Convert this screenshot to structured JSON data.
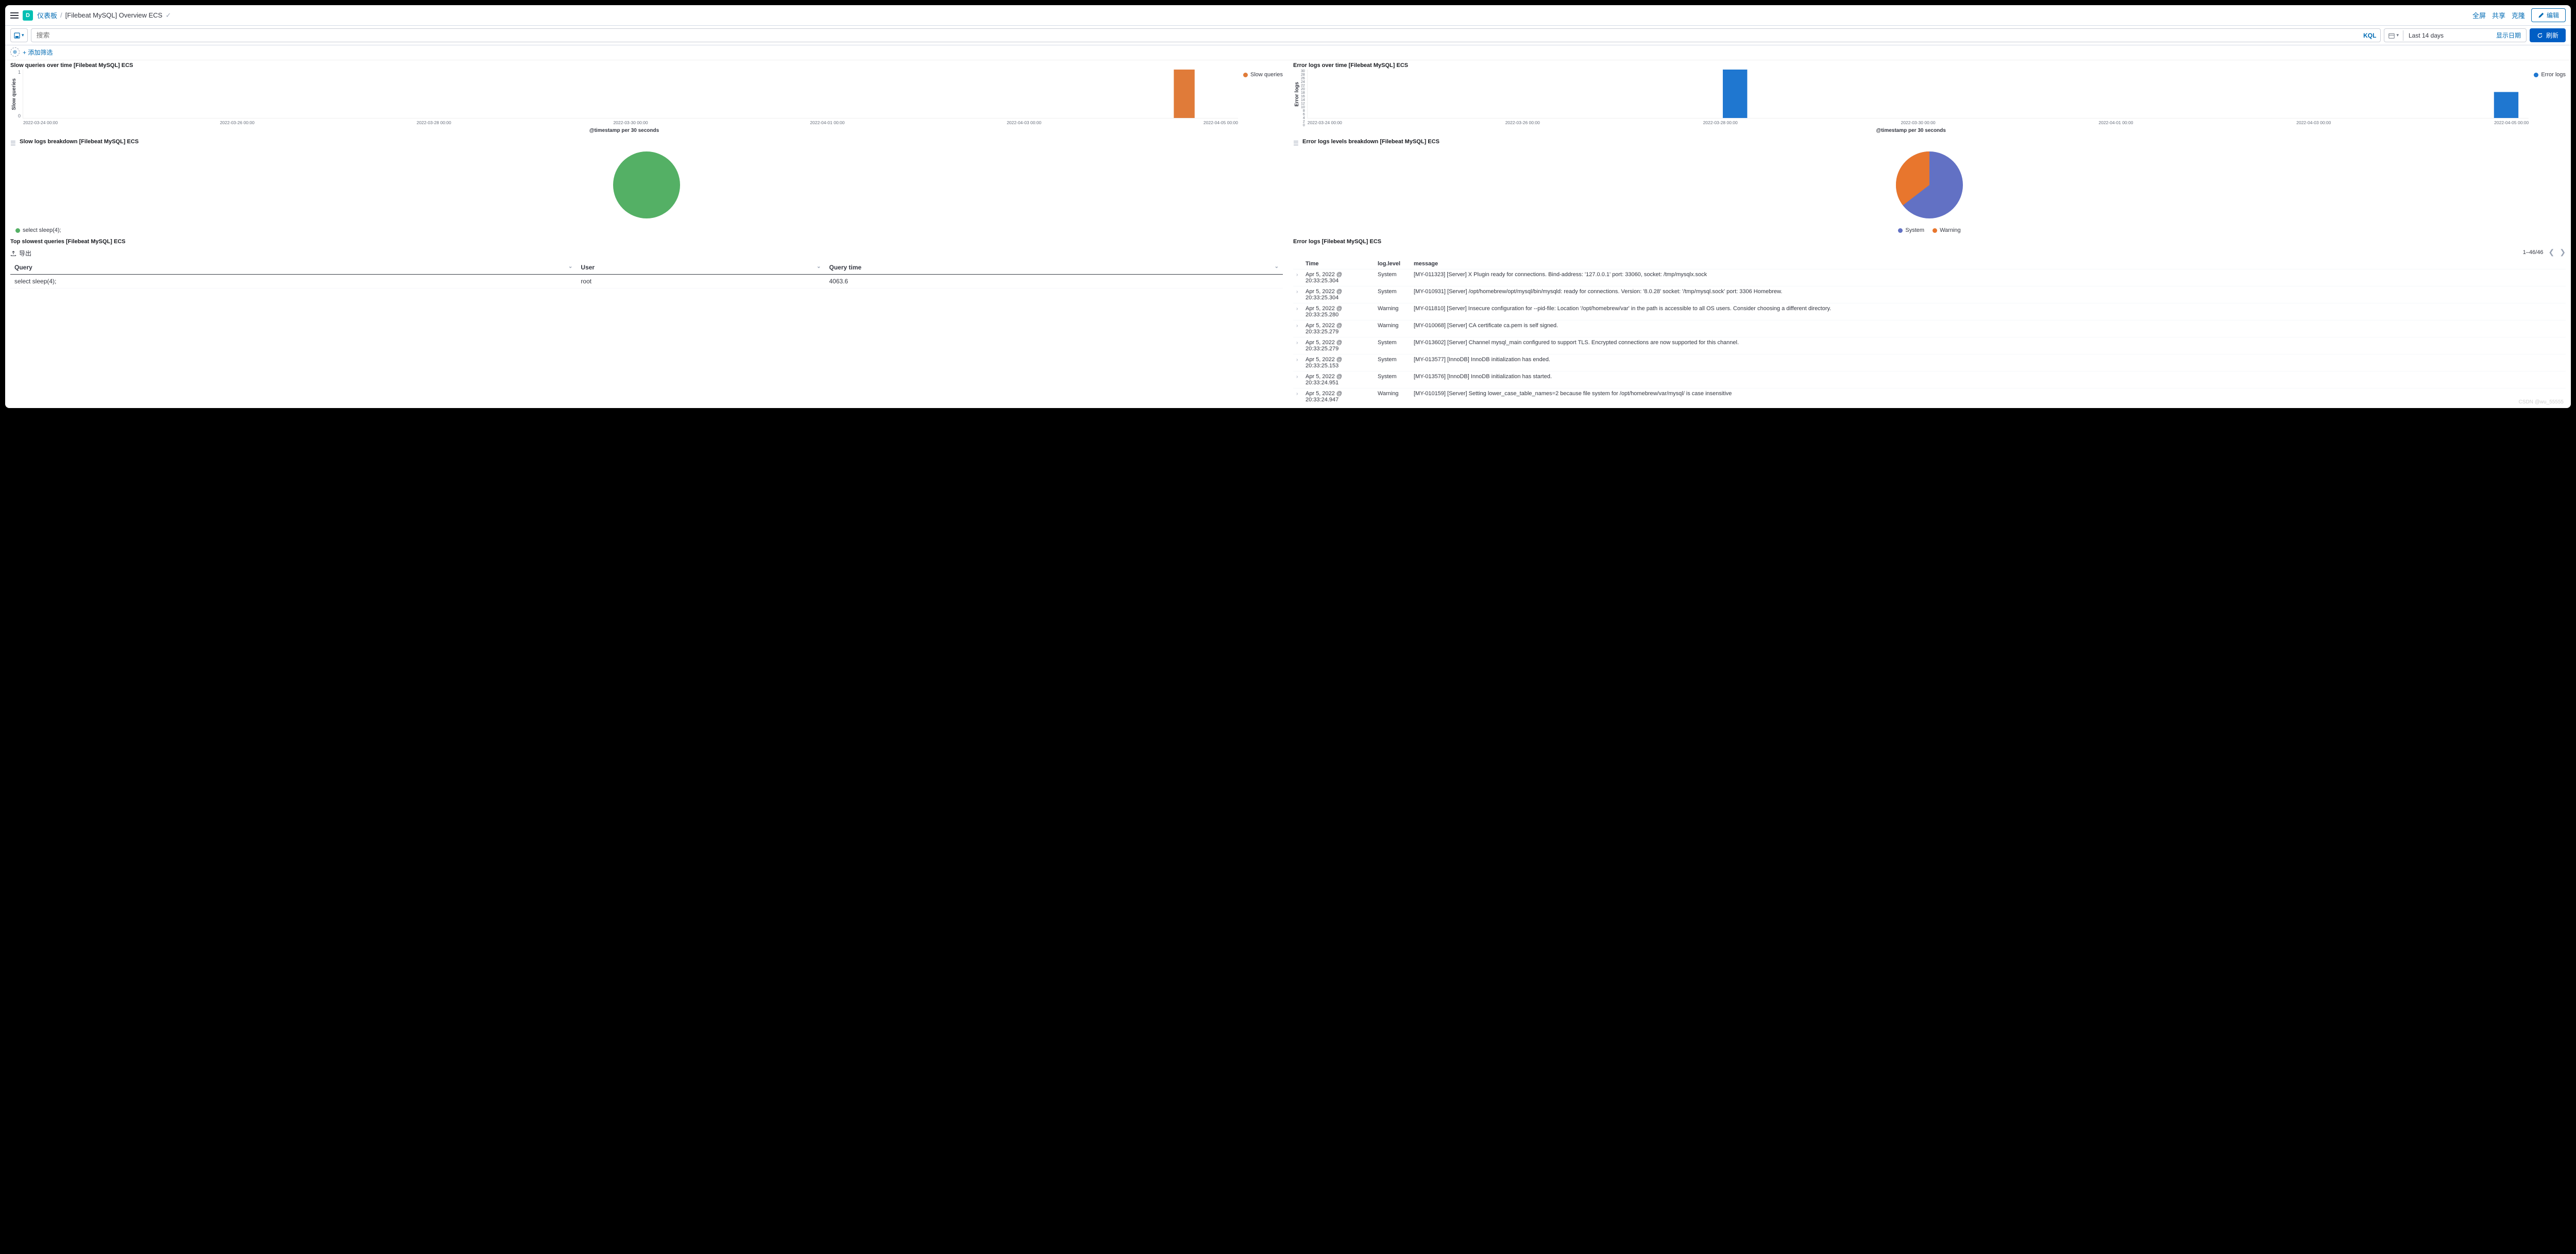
{
  "header": {
    "breadcrumb_root": "仪表板",
    "breadcrumb_current": "[Filebeat MySQL] Overview ECS",
    "fullscreen": "全屏",
    "share": "共享",
    "clone": "克隆",
    "edit": "编辑"
  },
  "querybar": {
    "search_placeholder": "搜索",
    "kql": "KQL",
    "date_range": "Last 14 days",
    "show_date": "显示日期",
    "refresh": "刷新",
    "add_filter": "+ 添加筛选"
  },
  "panels": {
    "slow_over_time": {
      "title": "Slow queries over time [Filebeat MySQL] ECS",
      "y_label": "Slow queries",
      "x_label": "@timestamp per 30 seconds",
      "legend": "Slow queries",
      "color": "#e07b39",
      "y_ticks": [
        "1",
        "0"
      ],
      "x_ticks": [
        "2022-03-24 00:00",
        "2022-03-26 00:00",
        "2022-03-28 00:00",
        "2022-03-30 00:00",
        "2022-04-01 00:00",
        "2022-04-03 00:00",
        "2022-04-05 00:00"
      ]
    },
    "error_over_time": {
      "title": "Error logs over time [Filebeat MySQL] ECS",
      "y_label": "Error logs",
      "x_label": "@timestamp per 30 seconds",
      "legend": "Error logs",
      "color": "#1f77d0",
      "y_ticks": [
        "30",
        "28",
        "26",
        "24",
        "22",
        "20",
        "18",
        "16",
        "14",
        "12",
        "10",
        "8",
        "6",
        "4",
        "2",
        "0"
      ],
      "x_ticks": [
        "2022-03-24 00:00",
        "2022-03-26 00:00",
        "2022-03-28 00:00",
        "2022-03-30 00:00",
        "2022-04-01 00:00",
        "2022-04-03 00:00",
        "2022-04-05 00:00"
      ]
    },
    "slow_breakdown": {
      "title": "Slow logs breakdown [Filebeat MySQL] ECS",
      "legend": [
        {
          "label": "select sleep(4);",
          "color": "#54b065"
        }
      ]
    },
    "error_breakdown": {
      "title": "Error logs levels breakdown [Filebeat MySQL] ECS",
      "legend": [
        {
          "label": "System",
          "color": "#6271c4"
        },
        {
          "label": "Warning",
          "color": "#e8762d"
        }
      ]
    },
    "top_slowest": {
      "title": "Top slowest queries [Filebeat MySQL] ECS",
      "export": "导出",
      "columns": [
        "Query",
        "User",
        "Query time"
      ],
      "rows": [
        {
          "query": "select sleep(4);",
          "user": "root",
          "time": "4063.6"
        }
      ]
    },
    "error_logs": {
      "title": "Error logs [Filebeat MySQL] ECS",
      "pager": "1–46/46",
      "columns": {
        "time": "Time",
        "level": "log.level",
        "message": "message"
      },
      "rows": [
        {
          "time": "Apr 5, 2022 @ 20:33:25.304",
          "level": "System",
          "message": "[MY-011323] [Server] X Plugin ready for connections. Bind-address: '127.0.0.1' port: 33060, socket: /tmp/mysqlx.sock"
        },
        {
          "time": "Apr 5, 2022 @ 20:33:25.304",
          "level": "System",
          "message": "[MY-010931] [Server] /opt/homebrew/opt/mysql/bin/mysqld: ready for connections. Version: '8.0.28' socket: '/tmp/mysql.sock' port: 3306 Homebrew."
        },
        {
          "time": "Apr 5, 2022 @ 20:33:25.280",
          "level": "Warning",
          "message": "[MY-011810] [Server] Insecure configuration for --pid-file: Location '/opt/homebrew/var' in the path is accessible to all OS users. Consider choosing a different directory."
        },
        {
          "time": "Apr 5, 2022 @ 20:33:25.279",
          "level": "Warning",
          "message": "[MY-010068] [Server] CA certificate ca.pem is self signed."
        },
        {
          "time": "Apr 5, 2022 @ 20:33:25.279",
          "level": "System",
          "message": "[MY-013602] [Server] Channel mysql_main configured to support TLS. Encrypted connections are now supported for this channel."
        },
        {
          "time": "Apr 5, 2022 @ 20:33:25.153",
          "level": "System",
          "message": "[MY-013577] [InnoDB] InnoDB initialization has ended."
        },
        {
          "time": "Apr 5, 2022 @ 20:33:24.951",
          "level": "System",
          "message": "[MY-013576] [InnoDB] InnoDB initialization has started."
        },
        {
          "time": "Apr 5, 2022 @ 20:33:24.947",
          "level": "Warning",
          "message": "[MY-010159] [Server] Setting lower_case_table_names=2 because file system for /opt/homebrew/var/mysql/ is case insensitive"
        }
      ]
    }
  },
  "watermark": "CSDN @wu_55555",
  "chart_data": [
    {
      "id": "slow_queries_over_time",
      "type": "bar",
      "title": "Slow queries over time [Filebeat MySQL] ECS",
      "xlabel": "@timestamp per 30 seconds",
      "ylabel": "Slow queries",
      "ylim": [
        0,
        1
      ],
      "series": [
        {
          "name": "Slow queries",
          "color": "#e07b39"
        }
      ],
      "x_range": [
        "2022-03-24 00:00",
        "2022-04-06 00:00"
      ],
      "bars": [
        {
          "x": "2022-04-05 20:33:00",
          "y": 1
        }
      ]
    },
    {
      "id": "error_logs_over_time",
      "type": "bar",
      "title": "Error logs over time [Filebeat MySQL] ECS",
      "xlabel": "@timestamp per 30 seconds",
      "ylabel": "Error logs",
      "ylim": [
        0,
        30
      ],
      "series": [
        {
          "name": "Error logs",
          "color": "#1f77d0"
        }
      ],
      "x_range": [
        "2022-03-24 00:00",
        "2022-04-06 00:00"
      ],
      "bars": [
        {
          "x": "2022-03-28 17:00",
          "y": 30
        },
        {
          "x": "2022-04-05 20:33",
          "y": 16
        }
      ]
    },
    {
      "id": "slow_logs_breakdown",
      "type": "pie",
      "title": "Slow logs breakdown [Filebeat MySQL] ECS",
      "slices": [
        {
          "label": "select sleep(4);",
          "value": 100,
          "color": "#54b065"
        }
      ]
    },
    {
      "id": "error_logs_levels_breakdown",
      "type": "pie",
      "title": "Error logs levels breakdown [Filebeat MySQL] ECS",
      "slices": [
        {
          "label": "System",
          "value": 70,
          "color": "#6271c4"
        },
        {
          "label": "Warning",
          "value": 30,
          "color": "#e8762d"
        }
      ]
    },
    {
      "id": "top_slowest_queries",
      "type": "table",
      "title": "Top slowest queries [Filebeat MySQL] ECS",
      "columns": [
        "Query",
        "User",
        "Query time"
      ],
      "rows": [
        [
          "select sleep(4);",
          "root",
          4063.6
        ]
      ]
    }
  ]
}
